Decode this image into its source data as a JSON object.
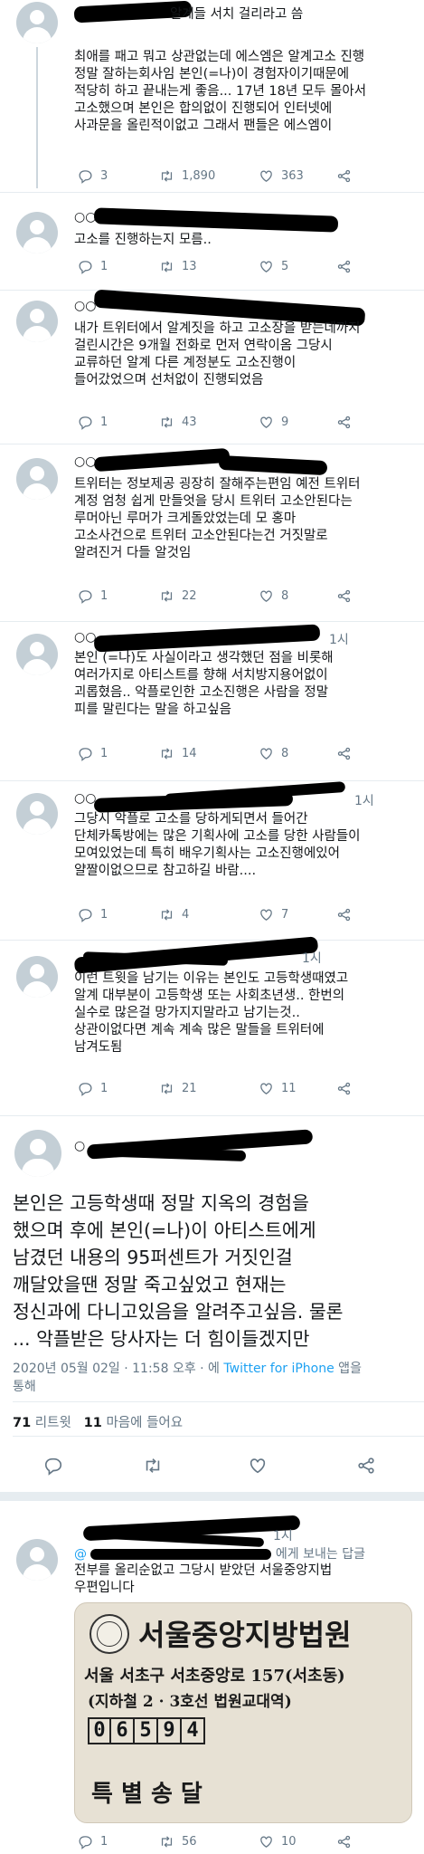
{
  "tweets": [
    {
      "header_suffix": "알계들 서치 걸리라고 씀",
      "lines": [
        "최애를 패고 뭐고 상관없는데 에스엠은 알계고소 진행",
        "정말 잘하는회사임 본인(=나)이 경험자이기때문에",
        "적당히 하고 끝내는게 좋음... 17년 18년 모두 몰아서",
        "고소했으며 본인은 합의없이 진행되어 인터넷에",
        "사과문을 올린적이없고 그래서 팬들은 에스엠이"
      ],
      "replies": "3",
      "retweets": "1,890",
      "likes": "363"
    },
    {
      "header_suffix": "",
      "lines": [
        "고소를 진행하는지 모름.."
      ],
      "replies": "1",
      "retweets": "13",
      "likes": "5"
    },
    {
      "header_suffix": "",
      "lines": [
        "내가 트위터에서 알계짓을 하고 고소장을 받는데까지",
        "걸린시간은 9개월 전화로 먼저 연락이옴 그당시",
        "교류하던 알계 다른 계정분도 고소진행이",
        "들어갔었으며 선처없이 진행되었음"
      ],
      "replies": "1",
      "retweets": "43",
      "likes": "9"
    },
    {
      "header_suffix": "",
      "lines": [
        "트위터는 정보제공 굉장히 잘해주는편임 예전 트위터",
        "계정 엄청 쉽게 만들엇을 당시 트위터 고소안된다는",
        "루머아닌 루머가 크게돌았었는데 모 홍마",
        "고소사건으로 트위터 고소안된다는건 거짓말로",
        "알려진거 다들 알것임"
      ],
      "replies": "1",
      "retweets": "22",
      "likes": "8"
    },
    {
      "header_suffix": "1시",
      "lines": [
        "본인 (=나)도 사실이라고 생각했던 점을 비롯해",
        "여러가지로 아티스트를 향해 서치방지용어없이",
        "괴롭혔음.. 악플로인한 고소진행은 사람을 정말",
        "피를 말린다는 말을 하고싶음"
      ],
      "replies": "1",
      "retweets": "14",
      "likes": "8"
    },
    {
      "header_suffix": "1시",
      "lines": [
        "그당시 악플로 고소를 당하게되면서 들어간",
        "단체카톡방에는 많은 기획사에 고소를 당한 사람들이",
        "모여있었는데 특히 배우기획사는 고소진행에있어",
        "얄짤이없으므로 참고하길 바람...."
      ],
      "replies": "1",
      "retweets": "4",
      "likes": "7"
    },
    {
      "header_suffix": "1시",
      "lines": [
        "이런 트윗을 남기는 이유는 본인도 고등학생때였고",
        "알계 대부분이 고등학생 또는 사회초년생.. 한번의",
        "실수로 많은걸 망가지지말라고 남기는것..",
        "상관이없다면 계속 계속 많은 말들을 트위터에",
        "남겨도됨"
      ],
      "replies": "1",
      "retweets": "21",
      "likes": "11"
    }
  ],
  "main": {
    "lines": [
      "본인은 고등학생때 정말 지옥의 경험을",
      "했으며 후에 본인(=나)이 아티스트에게",
      "남겼던 내용의 95퍼센트가 거짓인걸",
      "깨달았을땐 정말 죽고싶었고 현재는",
      "정신과에 다니고있음을 알려주고싶음. 물론",
      "... 악플받은 당사자는 더 힘이들겠지만"
    ],
    "date": "2020년 05월 02일 · 11:58 오후 · 에 ",
    "client": "Twitter for iPhone",
    "client_suffix": " 앱을",
    "meta_line2": "통해",
    "retweet_count": "71",
    "retweet_label": "리트윗",
    "like_count": "11",
    "like_label": "마음에 들어요"
  },
  "reply": {
    "header_suffix": "1시",
    "reply_to_suffix": "에게 보내는 답글",
    "lines": [
      "전부를 올리순없고 그당시 받았던 서울중앙지법",
      "우편입니다"
    ],
    "doc": {
      "court": "서울중앙지방법원",
      "address": "서울 서초구 서초중앙로 157(서초동)",
      "subway": "(지하철 2 · 3호선 법원교대역)",
      "postcode": [
        "0",
        "6",
        "5",
        "9",
        "4"
      ],
      "cut_text": "특 별 송 달"
    },
    "replies": "1",
    "retweets": "56",
    "likes": "10"
  }
}
